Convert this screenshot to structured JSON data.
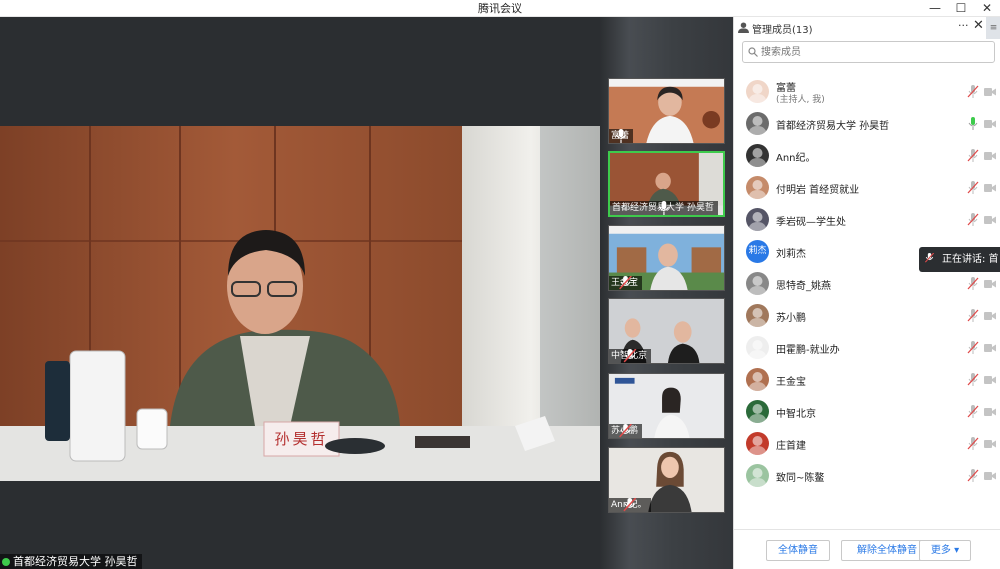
{
  "window": {
    "title": "腾讯会议",
    "minimize_glyph": "—",
    "maximize_glyph": "☐",
    "close_glyph": "✕"
  },
  "main_video": {
    "speaker_label": "首都经济贸易大学 孙昊哲",
    "nameplate": "孙昊哲"
  },
  "thumbnails": [
    {
      "name": "富蕾",
      "active": false
    },
    {
      "name": "首都经济贸易大学 孙昊哲",
      "active": true
    },
    {
      "name": "王金宝",
      "active": false
    },
    {
      "name": "中智北京",
      "active": false
    },
    {
      "name": "苏小鹏",
      "active": false
    },
    {
      "name": "Ann纪。",
      "active": false
    }
  ],
  "panel": {
    "title": "管理成员(13)",
    "more_glyph": "···",
    "close_glyph": "✕",
    "side_glyph": "≡",
    "search_placeholder": "搜索成员",
    "members": [
      {
        "name": "富蕾",
        "sub": "(主持人, 我)",
        "mic": "muted"
      },
      {
        "name": "首都经济贸易大学 孙昊哲",
        "mic": "active"
      },
      {
        "name": "Ann纪。",
        "mic": "muted"
      },
      {
        "name": "付明岩 首经贸就业",
        "mic": "muted"
      },
      {
        "name": "季岩砚—学生处",
        "mic": "muted"
      },
      {
        "name": "刘莉杰",
        "avatar_text": "莉杰",
        "mic": "hidden"
      },
      {
        "name": "思特奇_姚燕",
        "mic": "muted"
      },
      {
        "name": "苏小鹏",
        "mic": "muted"
      },
      {
        "name": "田霍鹏-就业办",
        "mic": "muted"
      },
      {
        "name": "王金宝",
        "mic": "muted"
      },
      {
        "name": "中智北京",
        "mic": "muted"
      },
      {
        "name": "庄首建",
        "mic": "muted"
      },
      {
        "name": "致同~陈鳌",
        "mic": "muted"
      }
    ],
    "speaking_tip": "正在讲话: 首",
    "footer": {
      "mute_all": "全体静音",
      "unmute_all": "解除全体静音",
      "more": "更多 ▾"
    }
  },
  "colors": {
    "accent": "#2a79e6",
    "active_green": "#3ecb4c",
    "muted_red": "#e04a4a",
    "stage_bg": "#2b2e31"
  }
}
